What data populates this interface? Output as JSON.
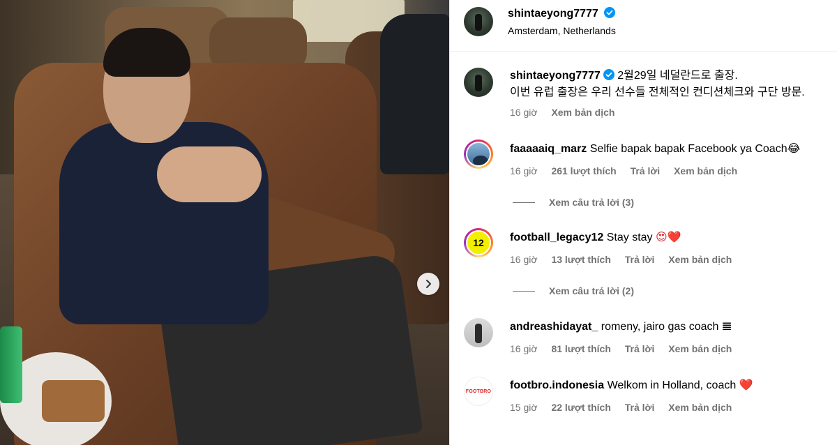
{
  "post": {
    "username": "shintaeyong7777",
    "location": "Amsterdam, Netherlands"
  },
  "caption": {
    "username": "shintaeyong7777",
    "line1": "2월29일 네덜란드로 출장.",
    "line2": "이번 유럽 출장은 우리 선수들 전체적인 컨디션체크와 구단 방문.",
    "time": "16 giờ",
    "translate": "Xem bản dịch"
  },
  "comments": [
    {
      "username": "faaaaaiq_marz",
      "text": "Selfie bapak bapak Facebook ya Coach",
      "emoji": "😂",
      "time": "16 giờ",
      "likes": "261 lượt thích",
      "reply": "Trả lời",
      "translate": "Xem bản dịch",
      "view_replies": "Xem câu trả lời (3)"
    },
    {
      "username": "football_legacy12",
      "avatar_text": "12",
      "text": "Stay stay",
      "emoji": "😍❤️",
      "time": "16 giờ",
      "likes": "13 lượt thích",
      "reply": "Trả lời",
      "translate": "Xem bản dịch",
      "view_replies": "Xem câu trả lời (2)"
    },
    {
      "username": "andreashidayat_",
      "text": "romeny, jairo gas coach",
      "emoji": "𝌆",
      "time": "16 giờ",
      "likes": "81 lượt thích",
      "reply": "Trả lời",
      "translate": "Xem bản dịch"
    },
    {
      "username": "footbro.indonesia",
      "avatar_text": "FOOTBRO",
      "text": "Welkom in Holland, coach",
      "emoji": "❤️",
      "time": "15 giờ",
      "likes": "22 lượt thích",
      "reply": "Trả lời",
      "translate": "Xem bản dịch"
    }
  ],
  "colors": {
    "verified": "#0095f6",
    "meta": "#737373",
    "heart": "#e11d2a"
  }
}
